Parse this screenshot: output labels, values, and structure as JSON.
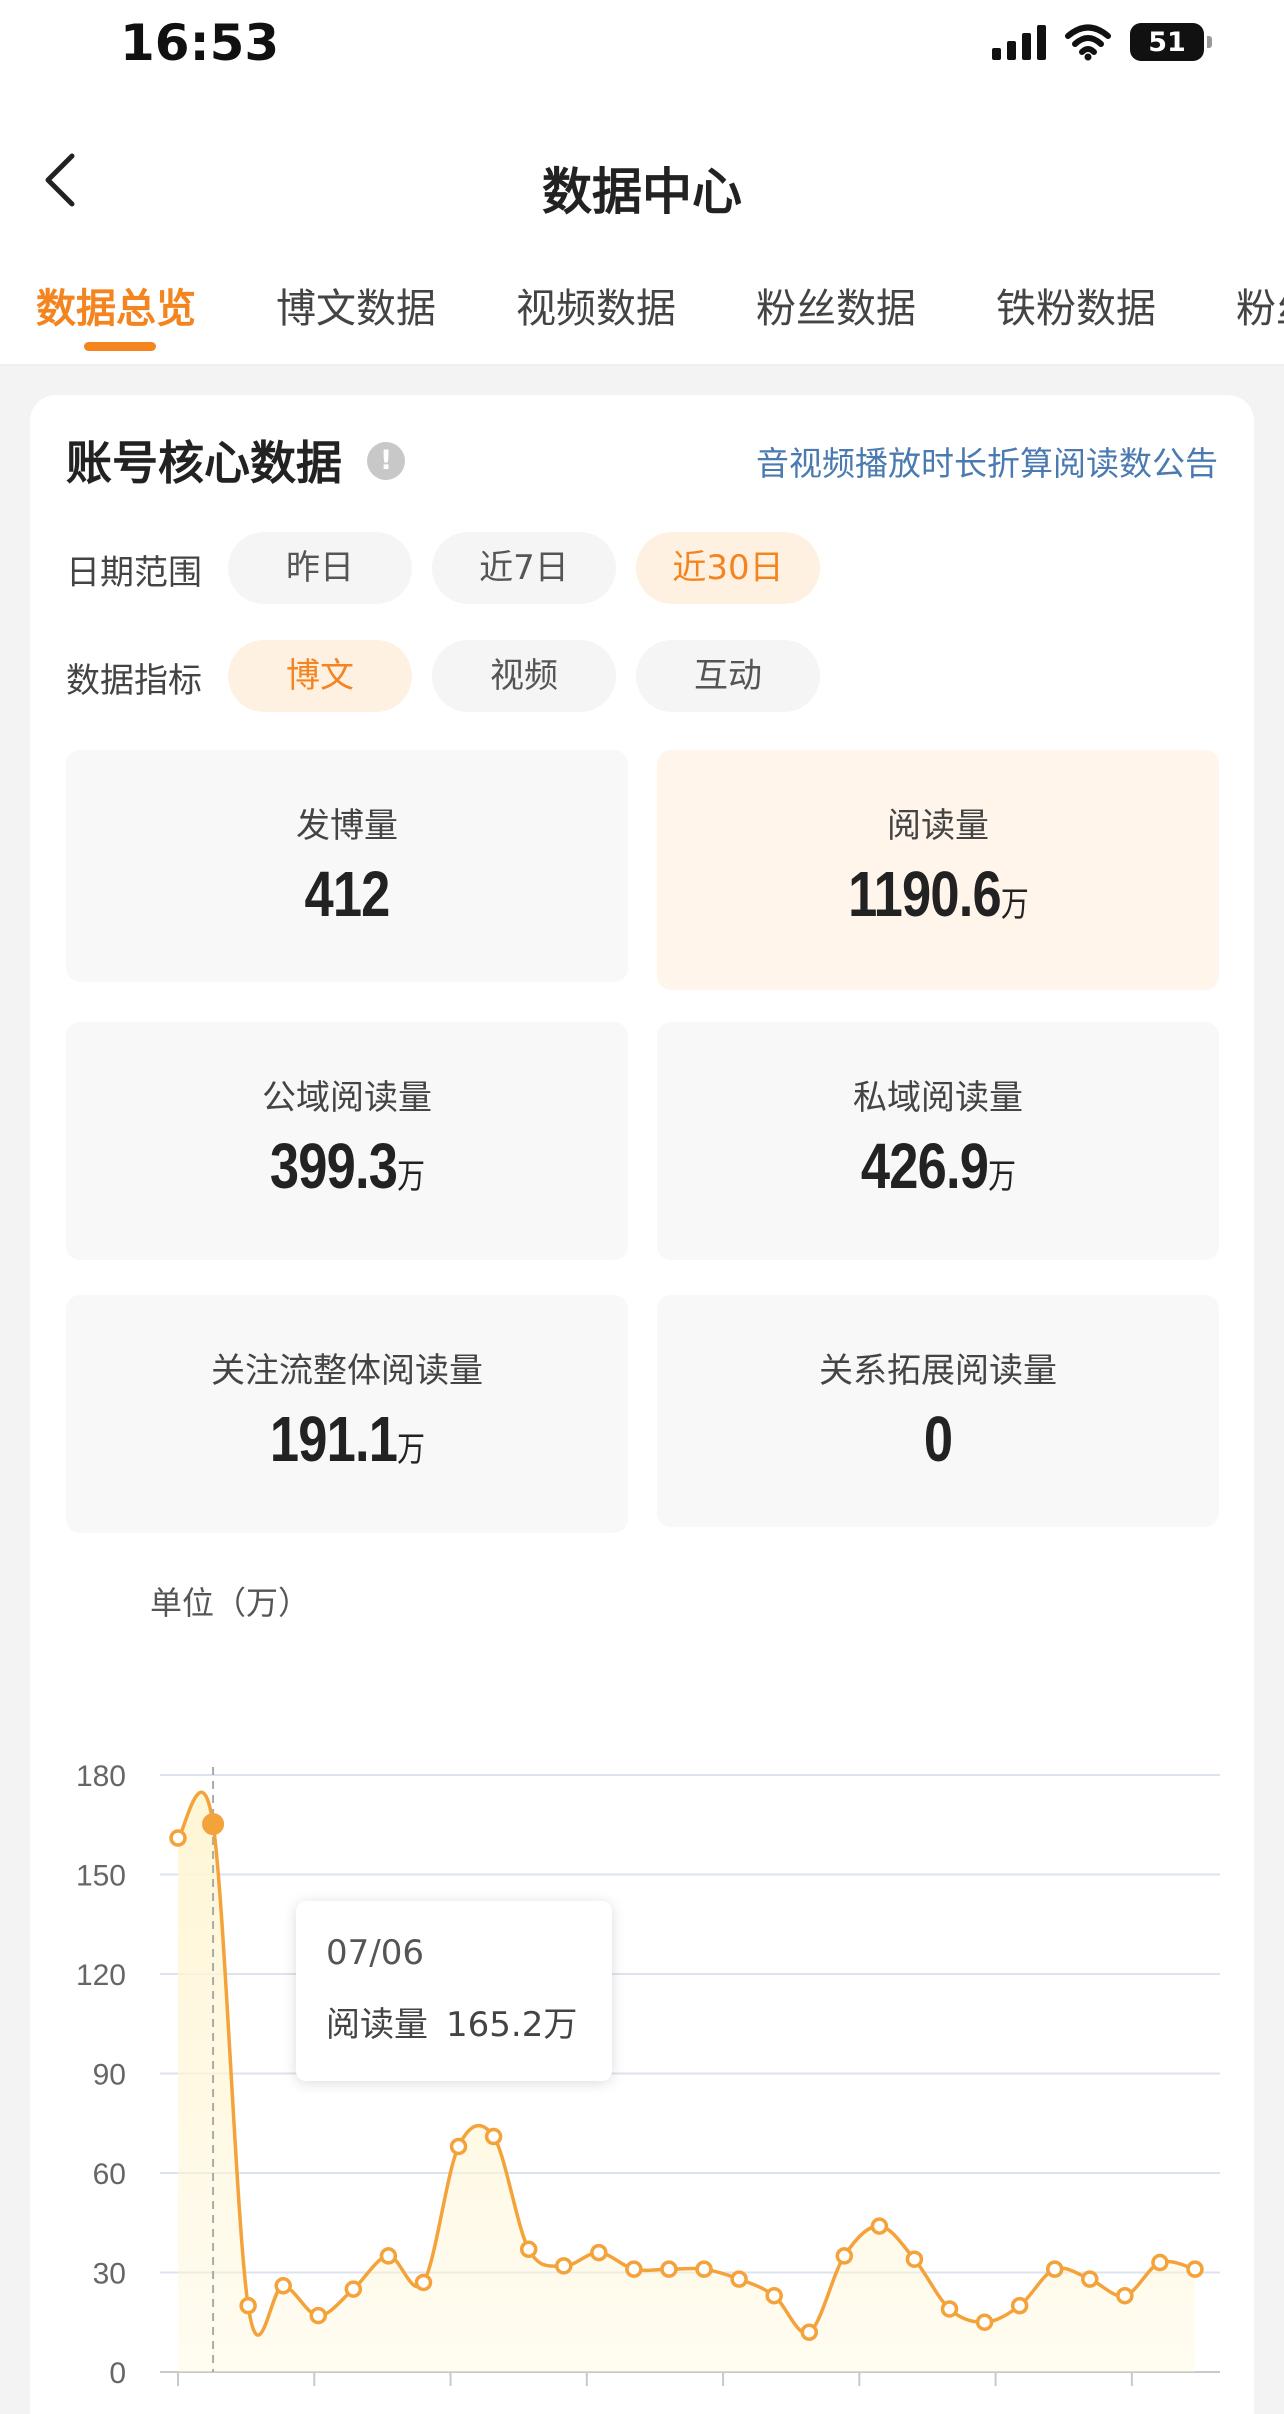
{
  "status_bar": {
    "time": "16:53",
    "battery": "51"
  },
  "nav": {
    "title": "数据中心"
  },
  "tabs": [
    {
      "label": "数据总览",
      "active": true
    },
    {
      "label": "博文数据",
      "active": false
    },
    {
      "label": "视频数据",
      "active": false
    },
    {
      "label": "粉丝数据",
      "active": false
    },
    {
      "label": "铁粉数据",
      "active": false
    },
    {
      "label": "粉丝",
      "active": false
    }
  ],
  "core": {
    "title": "账号核心数据",
    "notice_link": "音视频播放时长折算阅读数公告",
    "date_range": {
      "label": "日期范围",
      "options": [
        "昨日",
        "近7日",
        "近30日"
      ],
      "selected": "近30日"
    },
    "metric": {
      "label": "数据指标",
      "options": [
        "博文",
        "视频",
        "互动"
      ],
      "selected": "博文"
    },
    "stats": [
      {
        "label": "发博量",
        "value": "412",
        "unit": "",
        "highlight": false
      },
      {
        "label": "阅读量",
        "value": "1190.6",
        "unit": "万",
        "highlight": true
      },
      {
        "label": "公域阅读量",
        "value": "399.3",
        "unit": "万",
        "highlight": false
      },
      {
        "label": "私域阅读量",
        "value": "426.9",
        "unit": "万",
        "highlight": false
      },
      {
        "label": "关注流整体阅读量",
        "value": "191.1",
        "unit": "万",
        "highlight": false
      },
      {
        "label": "关系拓展阅读量",
        "value": "0",
        "unit": "",
        "highlight": false
      }
    ]
  },
  "chart_data": {
    "type": "area",
    "ylabel": "单位（万）",
    "ylim": [
      0,
      180
    ],
    "yticks": [
      0,
      30,
      60,
      90,
      120,
      150,
      180
    ],
    "grid": true,
    "series": [
      {
        "values": [
          161,
          165.2,
          20,
          26,
          17,
          25,
          35,
          27,
          68,
          71,
          37,
          32,
          36,
          31,
          31,
          31,
          28,
          23,
          12,
          35,
          44,
          34,
          19,
          15,
          20,
          31,
          28,
          23,
          33,
          31
        ]
      }
    ],
    "highlight_index": 1,
    "tooltip": {
      "date": "07/06",
      "label": "阅读量",
      "value": "165.2万"
    },
    "colors": {
      "line": "#f4a23a",
      "fill": "#fff6d6",
      "grid": "#dde3ee"
    }
  }
}
